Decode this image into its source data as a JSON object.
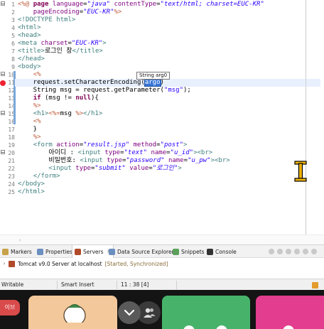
{
  "editor": {
    "lines": [
      {
        "n": "1",
        "segs": [
          [
            "jsp",
            "<%@ "
          ],
          [
            "kw",
            "page "
          ],
          [
            "attr",
            "language"
          ],
          [
            "txt",
            "="
          ],
          [
            "val",
            "\"java\""
          ],
          [
            "txt",
            " "
          ],
          [
            "attr",
            "contentType"
          ],
          [
            "txt",
            "="
          ],
          [
            "val",
            "\"text/html; charset=EUC-KR\""
          ]
        ]
      },
      {
        "n": "2",
        "segs": [
          [
            "txt",
            "    "
          ],
          [
            "attr",
            "pageEncoding"
          ],
          [
            "txt",
            "="
          ],
          [
            "val",
            "\"EUC-KR\""
          ],
          [
            "jsp",
            "%>"
          ]
        ]
      },
      {
        "n": "3",
        "segs": [
          [
            "tag",
            "<!DOCTYPE html>"
          ]
        ]
      },
      {
        "n": "4",
        "segs": [
          [
            "tag",
            "<html>"
          ]
        ]
      },
      {
        "n": "5",
        "segs": [
          [
            "tag",
            "<head>"
          ]
        ]
      },
      {
        "n": "6",
        "segs": [
          [
            "tag",
            "<meta "
          ],
          [
            "attr",
            "charset"
          ],
          [
            "txt",
            "="
          ],
          [
            "val",
            "\"EUC-KR\""
          ],
          [
            "tag",
            ">"
          ]
        ]
      },
      {
        "n": "7",
        "segs": [
          [
            "tag",
            "<title>"
          ],
          [
            "txt",
            "로그인 창"
          ],
          [
            "tag",
            "</title>"
          ]
        ]
      },
      {
        "n": "8",
        "segs": [
          [
            "tag",
            "</head>"
          ]
        ]
      },
      {
        "n": "9",
        "segs": [
          [
            "tag",
            "<body>"
          ]
        ]
      },
      {
        "n": "10",
        "segs": [
          [
            "txt",
            "    "
          ],
          [
            "jsp",
            "<%"
          ]
        ]
      },
      {
        "n": "11",
        "segs": [
          [
            "txt",
            "    request.setCharacterEncoding("
          ],
          [
            "sel",
            "argo"
          ],
          [
            "txt",
            ")"
          ]
        ]
      },
      {
        "n": "12",
        "segs": [
          [
            "txt",
            "    String msg = request.getParameter("
          ],
          [
            "str",
            "\"msg\""
          ],
          [
            "txt",
            ");"
          ]
        ]
      },
      {
        "n": "13",
        "segs": [
          [
            "txt",
            "    "
          ],
          [
            "kw",
            "if"
          ],
          [
            "txt",
            " (msg != "
          ],
          [
            "kw",
            "null"
          ],
          [
            "txt",
            "){"
          ]
        ]
      },
      {
        "n": "14",
        "segs": [
          [
            "txt",
            "    "
          ],
          [
            "jsp",
            "%>"
          ]
        ]
      },
      {
        "n": "15",
        "segs": [
          [
            "txt",
            "    "
          ],
          [
            "tag",
            "<h1>"
          ],
          [
            "jsp",
            "<%="
          ],
          [
            "txt",
            "msg "
          ],
          [
            "jsp",
            "%>"
          ],
          [
            "tag",
            "</h1>"
          ]
        ]
      },
      {
        "n": "16",
        "segs": [
          [
            "txt",
            "    "
          ],
          [
            "jsp",
            "<%"
          ]
        ]
      },
      {
        "n": "17",
        "segs": [
          [
            "txt",
            "    }"
          ]
        ]
      },
      {
        "n": "18",
        "segs": [
          [
            "txt",
            "    "
          ],
          [
            "jsp",
            "%>"
          ]
        ]
      },
      {
        "n": "19",
        "segs": [
          [
            "txt",
            "    "
          ],
          [
            "tag",
            "<form "
          ],
          [
            "attr",
            "action"
          ],
          [
            "txt",
            "="
          ],
          [
            "val",
            "\"result.jsp\""
          ],
          [
            "txt",
            " "
          ],
          [
            "attr",
            "method"
          ],
          [
            "txt",
            "="
          ],
          [
            "val",
            "\"post\""
          ],
          [
            "tag",
            ">"
          ]
        ]
      },
      {
        "n": "20",
        "segs": [
          [
            "txt",
            "        아이디 : "
          ],
          [
            "tag",
            "<input "
          ],
          [
            "attr",
            "type"
          ],
          [
            "txt",
            "="
          ],
          [
            "val",
            "\"text\""
          ],
          [
            "txt",
            " "
          ],
          [
            "attr",
            "name"
          ],
          [
            "txt",
            "="
          ],
          [
            "val",
            "\"u_id\""
          ],
          [
            "tag",
            "><br>"
          ]
        ]
      },
      {
        "n": "21",
        "segs": [
          [
            "txt",
            "        비밀번호: "
          ],
          [
            "tag",
            "<input "
          ],
          [
            "attr",
            "type"
          ],
          [
            "txt",
            "="
          ],
          [
            "val",
            "\"password\""
          ],
          [
            "txt",
            " "
          ],
          [
            "attr",
            "name"
          ],
          [
            "txt",
            "="
          ],
          [
            "val",
            "\"u_pw\""
          ],
          [
            "tag",
            "><br>"
          ]
        ]
      },
      {
        "n": "22",
        "segs": [
          [
            "txt",
            "        "
          ],
          [
            "tag",
            "<input "
          ],
          [
            "attr",
            "type"
          ],
          [
            "txt",
            "="
          ],
          [
            "val",
            "\"submit\""
          ],
          [
            "txt",
            " "
          ],
          [
            "attr",
            "value"
          ],
          [
            "txt",
            "="
          ],
          [
            "val",
            "\"로그인\""
          ],
          [
            "tag",
            ">"
          ]
        ]
      },
      {
        "n": "23",
        "segs": [
          [
            "txt",
            "    "
          ],
          [
            "tag",
            "</form>"
          ]
        ]
      },
      {
        "n": "24",
        "segs": [
          [
            "tag",
            "</body>"
          ]
        ]
      },
      {
        "n": "25",
        "segs": [
          [
            "tag",
            "</html>"
          ]
        ]
      }
    ],
    "tooltip": "String arg0"
  },
  "views": {
    "tabs": [
      {
        "label": "Markers",
        "icon_color": "#c8a24a",
        "active": false
      },
      {
        "label": "Properties",
        "icon_color": "#6b8fbf",
        "active": false
      },
      {
        "label": "Servers",
        "icon_color": "#b04a2a",
        "active": true
      },
      {
        "label": "Data Source Explorer",
        "icon_color": "#6b8fbf",
        "active": false
      },
      {
        "label": "Snippets",
        "icon_color": "#5aa05a",
        "active": false
      },
      {
        "label": "Console",
        "icon_color": "#333333",
        "active": false
      }
    ],
    "close_glyph": "✕",
    "servers": [
      {
        "name": "Tomcat v9.0 Server at localhost",
        "state": "[Started, Synchronized]"
      }
    ]
  },
  "status": {
    "writable": "Writable",
    "insert_mode": "Smart Insert",
    "position": "11 : 38 [4]"
  },
  "taskbar": {
    "badge_text": "이브",
    "tile_colors": [
      "#f3c89a",
      "#47b36a",
      "#e23d8e"
    ]
  }
}
